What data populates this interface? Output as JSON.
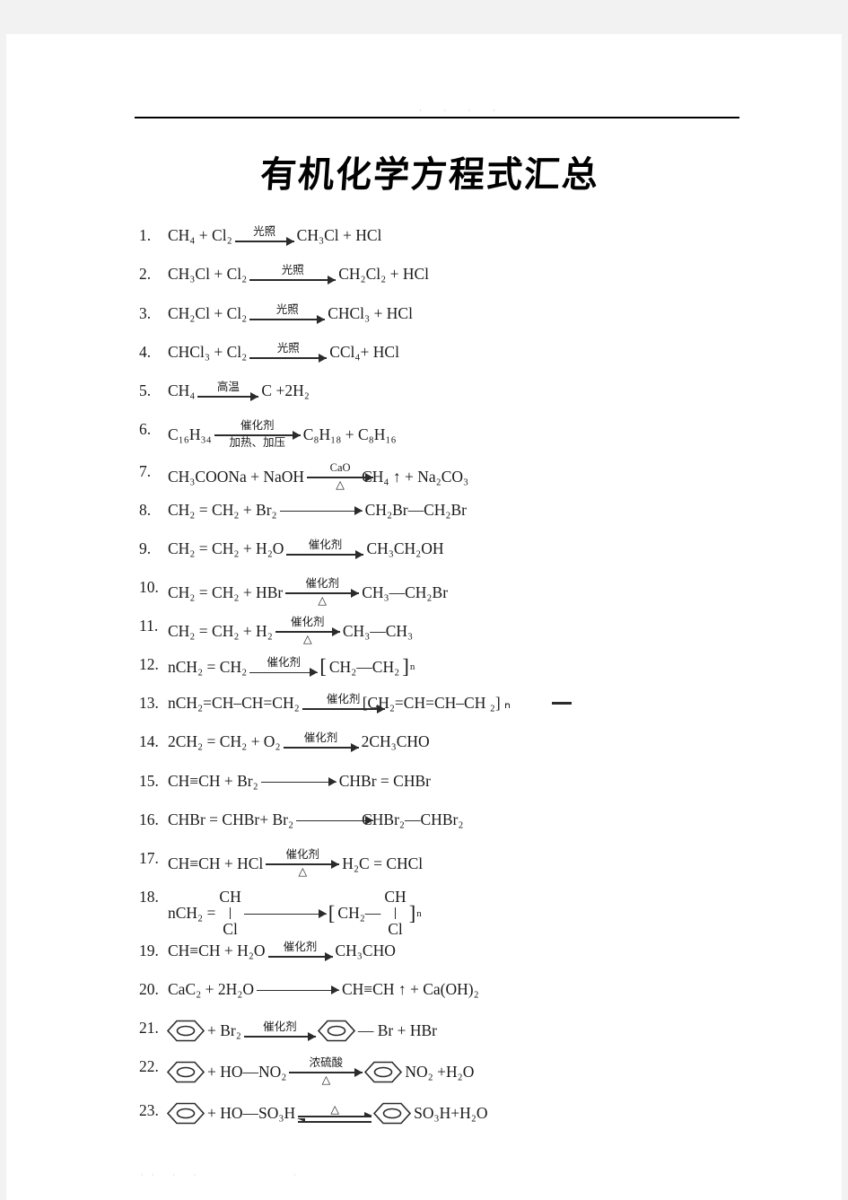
{
  "document": {
    "title": "有机化学方程式汇总",
    "header_dots": "· · · ·",
    "footer_dots_left": "·· · ·",
    "footer_dots_right": "·"
  },
  "labels": {
    "light": "光照",
    "high_temp": "高温",
    "catalyst": "催化剂",
    "heat_pressure": "加热、加压",
    "cao": "CaO",
    "delta": "△",
    "conc_sulfuric": "浓硫酸",
    "plus": "+",
    "equals": "=",
    "up_arrow": "↑",
    "bracket_open": "[",
    "bracket_close": "]",
    "sub_n": "n",
    "bond": "—",
    "cl_label": "Cl"
  },
  "equations": [
    {
      "num": "1.",
      "left": "CH₄ + Cl₂",
      "above": "光照",
      "below": "",
      "right": "CH₃Cl + HCl"
    },
    {
      "num": "2.",
      "left": "CH₃Cl + Cl₂",
      "above": "光照",
      "below": "",
      "right": "CH₂Cl₂ + HCl"
    },
    {
      "num": "3.",
      "left": "CH₂Cl + Cl₂",
      "above": "光照",
      "below": "",
      "right": "CHCl₃ + HCl"
    },
    {
      "num": "4.",
      "left": "CHCl₃ + Cl₂",
      "above": "光照",
      "below": "",
      "right": "CCl₄+ HCl"
    },
    {
      "num": "5.",
      "left": "CH₄",
      "above": "高温",
      "below": "",
      "right": "C +2H₂"
    },
    {
      "num": "6.",
      "left": "C₁₆H₃₄",
      "above": "催化剂",
      "below": "加热、加压",
      "right": "C₈H₁₈ + C₈H₁₆"
    },
    {
      "num": "7.",
      "left": "CH₃COONa + NaOH",
      "above": "CaO",
      "below": "△",
      "right": "CH₄ ↑ + Na₂CO₃"
    },
    {
      "num": "8.",
      "left": "CH₂ = CH₂ + Br₂",
      "above": "",
      "below": "",
      "right": "CH₂Br—CH₂Br"
    },
    {
      "num": "9.",
      "left": "CH₂ = CH₂ + H₂O",
      "above": "催化剂",
      "below": "",
      "right": "CH₃CH₂OH"
    },
    {
      "num": "10.",
      "left": "CH₂ = CH₂ + HBr",
      "above": "催化剂",
      "below": "△",
      "right": "CH₃—CH₂Br"
    },
    {
      "num": "11.",
      "left": "CH₂ = CH₂ + H₂",
      "above": "催化剂",
      "below": "△",
      "right": "CH₃—CH₃"
    },
    {
      "num": "12.",
      "left": "nCH₂ = CH₂",
      "above": "催化剂",
      "below": "",
      "right": "CH₂—CH₂",
      "polymer": true
    },
    {
      "num": "13.",
      "left": "nCH₂=CH–CH=CH₂",
      "above": "催化剂",
      "below": "",
      "right": "[CH₂=CH=CH–CH ₂] ₙ",
      "stray_dash": true
    },
    {
      "num": "14.",
      "left": "2CH₂ = CH₂ + O₂",
      "above": "催化剂",
      "below": "",
      "right": "2CH₃CHO"
    },
    {
      "num": "15.",
      "left": "CH≡CH + Br₂",
      "above": "",
      "below": "",
      "right": "CHBr = CHBr"
    },
    {
      "num": "16.",
      "left": "CHBr = CHBr+ Br₂",
      "above": "",
      "below": "",
      "right": "CHBr₂—CHBr₂"
    },
    {
      "num": "17.",
      "left": "CH≡CH + HCl",
      "above": "催化剂",
      "below": "△",
      "right": "H₂C = CHCl"
    },
    {
      "num": "18.",
      "left": "nCH₂ = CH",
      "left_sub": "Cl",
      "above": "",
      "below": "",
      "right": "CH₂—CH",
      "right_sub": "Cl",
      "polymer": true
    },
    {
      "num": "19.",
      "left": "CH≡CH + H₂O",
      "above": "催化剂",
      "below": "",
      "right": "CH₃CHO"
    },
    {
      "num": "20.",
      "left": "CaC₂ + 2H₂O",
      "above": "",
      "below": "",
      "right": "CH≡CH ↑ + Ca(OH)₂"
    },
    {
      "num": "21.",
      "left_benzene": true,
      "left": "+ Br₂",
      "above": "催化剂",
      "below": "",
      "right_benzene": true,
      "right": "— Br + HBr"
    },
    {
      "num": "22.",
      "left_benzene": true,
      "left": "+ HO—NO₂",
      "above": "浓硫酸",
      "below": "△",
      "right_benzene": true,
      "right": "NO₂ +H₂O"
    },
    {
      "num": "23.",
      "left_benzene": true,
      "left": "+ HO—SO₃H",
      "above": "△",
      "below": "",
      "reversible": true,
      "right_benzene": true,
      "right": "SO₃H+H₂O"
    }
  ]
}
